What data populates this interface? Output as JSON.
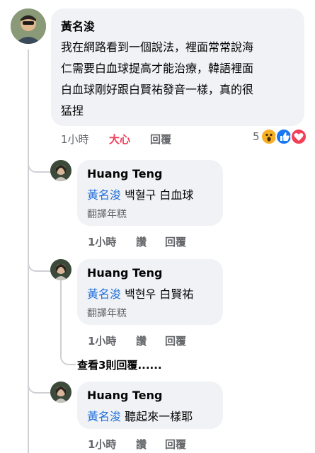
{
  "main_comment": {
    "author": "黃名浚",
    "lines": [
      "我在網路看到一個說法，裡面常常說海",
      "仁需要白血球提高才能治療，韓語裡面",
      "白血球剛好跟白賢祐發音一樣，真的很",
      "猛捏"
    ],
    "time": "1小時",
    "reaction_label": "大心",
    "reply_label": "回覆",
    "reaction_count": "5",
    "reaction_color": "#f33e58"
  },
  "replies": [
    {
      "author": "Huang Teng",
      "mention": "黃名浚",
      "text": "백혈구 白血球",
      "translate": "翻譯年糕",
      "time": "1小時",
      "like": "讚",
      "reply": "回覆"
    },
    {
      "author": "Huang Teng",
      "mention": "黃名浚",
      "text": "백현우 白賢祐",
      "translate": "翻譯年糕",
      "time": "1小時",
      "like": "讚",
      "reply": "回覆"
    },
    {
      "author": "Huang Teng",
      "mention": "黃名浚",
      "text": "聽起來一樣耶",
      "time": "1小時",
      "like": "讚",
      "reply": "回覆"
    }
  ],
  "more_replies": "查看3則回覆......",
  "icons": [
    "wow-reaction-icon",
    "like-reaction-icon",
    "love-reaction-icon"
  ]
}
